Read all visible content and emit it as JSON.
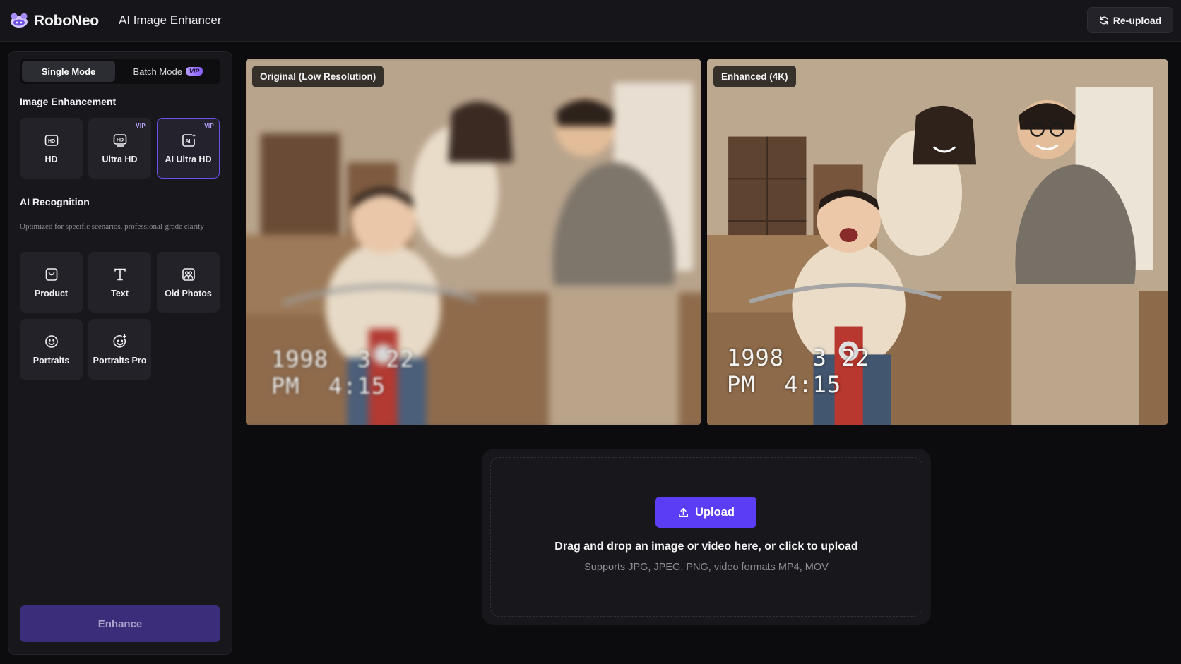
{
  "header": {
    "logo_text": "RoboNeo",
    "app_title": "AI Image Enhancer",
    "reupload_label": "Re-upload"
  },
  "sidebar": {
    "modes": {
      "single": "Single Mode",
      "batch": "Batch Mode",
      "batch_badge": "VIP"
    },
    "enhancement": {
      "title": "Image Enhancement",
      "tiles": [
        {
          "label": "HD",
          "icon": "hd-icon",
          "vip": ""
        },
        {
          "label": "Ultra HD",
          "icon": "ultra-hd-icon",
          "vip": "VIP"
        },
        {
          "label": "AI Ultra HD",
          "icon": "ai-ultra-hd-icon",
          "vip": "VIP",
          "selected": true
        }
      ]
    },
    "recognition": {
      "title": "AI Recognition",
      "subtitle": "Optimized for specific scenarios, professional-grade clarity",
      "tiles": [
        {
          "label": "Product",
          "icon": "shopping-bag-icon"
        },
        {
          "label": "Text",
          "icon": "text-icon"
        },
        {
          "label": "Old Photos",
          "icon": "old-photo-icon"
        },
        {
          "label": "Portraits",
          "icon": "smiley-face-icon"
        },
        {
          "label": "Portraits Pro",
          "icon": "smiley-face-sparkle-icon"
        }
      ]
    },
    "enhance_label": "Enhance"
  },
  "preview": {
    "original_label": "Original (Low Resolution)",
    "enhanced_label": "Enhanced (4K)",
    "stamp_date": "1998  3 22",
    "stamp_time": "PM  4:15"
  },
  "upload": {
    "button_label": "Upload",
    "main_text": "Drag and drop an image or video here, or click to upload",
    "sub_text": "Supports JPG, JPEG, PNG, video formats MP4, MOV"
  },
  "colors": {
    "accent": "#5b3df5",
    "enhance_disabled": "#3b2d7a",
    "background": "#0c0c0f",
    "panel": "#18181c",
    "vip": "#b59bff"
  }
}
